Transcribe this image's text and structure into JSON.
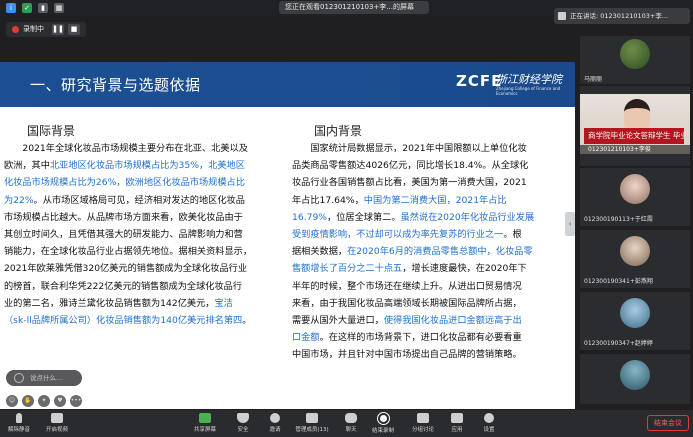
{
  "topbar": {
    "share_status": "您正在观看012301210103+李...的屏幕"
  },
  "recording": {
    "label": "录制中",
    "pause_icon": "pause-icon",
    "stop_icon": "stop-icon"
  },
  "slide": {
    "title": "一、研究背景与选题依据",
    "logo_text": "ZCFE",
    "logo_cn": "浙江财经学院",
    "logo_en": "Zhejiang College of Finance and Economics",
    "left": {
      "heading": "国际背景",
      "lines": [
        [
          {
            "t": "　　2021年全球化妆品市场规模主要分布在北亚、北美以及",
            "h": false
          }
        ],
        [
          {
            "t": "欧洲，其中",
            "h": false
          },
          {
            "t": "北亚地区化妆品市场规模占比为35%，北美地区",
            "h": true
          }
        ],
        [
          {
            "t": "化妆品市场规模占比为26%，欧洲地区化妆品市场规模占比",
            "h": true
          }
        ],
        [
          {
            "t": "为22%",
            "h": true
          },
          {
            "t": "。从市场区域格局可见，经济相对发达的地区化妆品",
            "h": false
          }
        ],
        [
          {
            "t": "市场规模占比越大。从品牌市场方面来看，欧美化妆品由于",
            "h": false
          }
        ],
        [
          {
            "t": "其创立时间久，且凭借其强大的研发能力、品牌影响力和营",
            "h": false
          }
        ],
        [
          {
            "t": "销能力，在全球化妆品行业占据领先地位。据相关资料显示，",
            "h": false
          }
        ],
        [
          {
            "t": "2021年欧莱雅凭借320亿美元的销售额成为全球化妆品行业",
            "h": false
          }
        ],
        [
          {
            "t": "的榜首，联合利华凭222亿美元的销售额成为全球化妆品行",
            "h": false
          }
        ],
        [
          {
            "t": "业的第二名，雅诗兰黛化妆品销售额为142亿美元，",
            "h": false
          },
          {
            "t": "宝洁",
            "h": true
          }
        ],
        [
          {
            "t": "（sk-ll品牌所属公司）化妆品销售额为140亿美元排名第四",
            "h": true
          },
          {
            "t": "。",
            "h": false
          }
        ]
      ]
    },
    "right": {
      "heading": "国内背景",
      "lines": [
        [
          {
            "t": "　　国家统计局数据显示，2021年中国限额以上单位化妆",
            "h": false
          }
        ],
        [
          {
            "t": "品类商品零售额达4026亿元，同比增长18.4%。从全球化",
            "h": false
          }
        ],
        [
          {
            "t": "妆品行业各国销售额占比看，美国为第一消费大国，2021",
            "h": false
          }
        ],
        [
          {
            "t": "年占比17.64%，",
            "h": false
          },
          {
            "t": "中国为第二消费大国，2021年占比",
            "h": true
          }
        ],
        [
          {
            "t": "16.79%",
            "h": true
          },
          {
            "t": "，位居全球第二。",
            "h": false
          },
          {
            "t": "虽然说在2020年化妆品行业发展",
            "h": true
          }
        ],
        [
          {
            "t": "受到疫情影响，不过却可以成为率先复苏的行业之一",
            "h": true
          },
          {
            "t": "。根",
            "h": false
          }
        ],
        [
          {
            "t": "据相关数据，",
            "h": false
          },
          {
            "t": "在2020年6月的消费品零售总额中，化妆品零",
            "h": true
          }
        ],
        [
          {
            "t": "售额增长了百分之二十点五",
            "h": true
          },
          {
            "t": "，增长速度最快，在2020年下",
            "h": false
          }
        ],
        [
          {
            "t": "半年的时候，整个市场还在继续上升。从进出口贸易情况",
            "h": false
          }
        ],
        [
          {
            "t": "来看，由于我国化妆品高端领域长期被国际品牌所占据，",
            "h": false
          }
        ],
        [
          {
            "t": "需要从国外大量进口，",
            "h": false
          },
          {
            "t": "使得我国化妆品进口金额远高于出",
            "h": true
          }
        ],
        [
          {
            "t": "口金额",
            "h": true
          },
          {
            "t": "。在这样的市场背景下，进口化妆品都有必要看重",
            "h": false
          }
        ],
        [
          {
            "t": "中国市场，并且针对中国市场提出自己品牌的营销策略。",
            "h": false
          }
        ]
      ]
    }
  },
  "chat": {
    "placeholder": "说点什么..."
  },
  "panel": {
    "toast": "正在讲话: 012301210103+李...",
    "participants": [
      {
        "name": "马丽丽"
      },
      {
        "name": "012301210103+李俊"
      },
      {
        "name": "012300190113+于红霞"
      },
      {
        "name": "012300190341+彭燕翔"
      },
      {
        "name": "012300190347+赵婷婷"
      }
    ],
    "video_banner": "商学院毕业论文答辩学生 毕业"
  },
  "toolbar": {
    "items": [
      {
        "label": "解除静音",
        "icon": "mic-off-icon"
      },
      {
        "label": "开启视频",
        "icon": "camera-off-icon"
      },
      {
        "label": "共享屏幕",
        "icon": "share-screen-icon"
      },
      {
        "label": "安全",
        "icon": "shield-icon"
      },
      {
        "label": "邀请",
        "icon": "invite-icon"
      },
      {
        "label": "管理成员(13)",
        "icon": "members-icon"
      },
      {
        "label": "聊天",
        "icon": "chat-icon"
      },
      {
        "label": "结束录制",
        "icon": "record-icon"
      },
      {
        "label": "分组讨论",
        "icon": "breakout-icon"
      },
      {
        "label": "应用",
        "icon": "apps-icon"
      },
      {
        "label": "设置",
        "icon": "settings-icon"
      }
    ],
    "end_label": "结束会议"
  },
  "colors": {
    "slide_header": "#1c4f93",
    "highlight_text": "#1f6fd0",
    "end_button": "#e53935",
    "video_banner": "#b3161e"
  }
}
